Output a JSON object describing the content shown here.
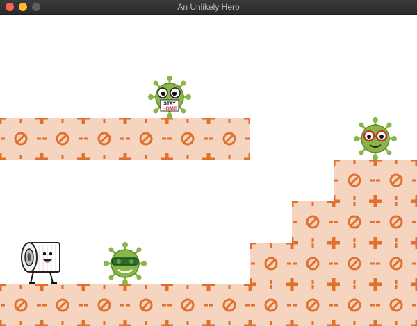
{
  "window": {
    "title": "An Unlikely Hero"
  },
  "colors": {
    "tile_fill": "#f5d5c0",
    "tile_accent": "#e0702b",
    "virus_green": "#8ab548",
    "virus_dark": "#5f8a2a",
    "background": "#ffffff"
  },
  "icons": {
    "block": "no-entry-icon",
    "hero": "toilet-paper-roll",
    "enemy": "virus-germ"
  },
  "virus_sign": {
    "line1": "STAY",
    "line2": "HOME"
  }
}
